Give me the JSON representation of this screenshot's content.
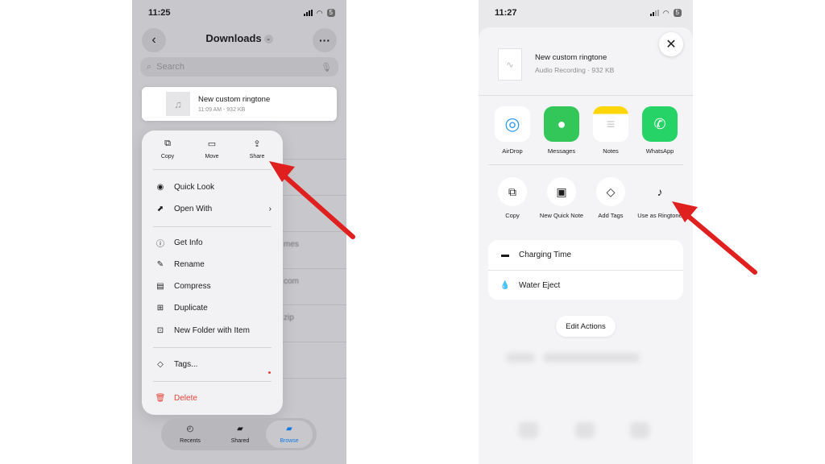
{
  "left": {
    "status": {
      "time": "11:25",
      "battery": "5"
    },
    "nav": {
      "title": "Downloads"
    },
    "search": {
      "placeholder": "Search"
    },
    "file": {
      "name": "New custom ringtone",
      "meta": "11:09 AM - 932 KB"
    },
    "background_fragments": [
      "mes",
      "com",
      "zip"
    ],
    "menu": {
      "top_actions": [
        {
          "label": "Copy",
          "icon": "copy-icon"
        },
        {
          "label": "Move",
          "icon": "folder-icon"
        },
        {
          "label": "Share",
          "icon": "share-icon"
        }
      ],
      "items": [
        {
          "label": "Quick Look",
          "icon": "eye-icon"
        },
        {
          "label": "Open With",
          "icon": "open-with-icon",
          "trailing": "›"
        },
        {
          "label": "Get Info",
          "icon": "info-icon"
        },
        {
          "label": "Rename",
          "icon": "pencil-icon"
        },
        {
          "label": "Compress",
          "icon": "archive-icon"
        },
        {
          "label": "Duplicate",
          "icon": "duplicate-icon"
        },
        {
          "label": "New Folder with Item",
          "icon": "new-folder-icon"
        },
        {
          "label": "Tags...",
          "icon": "tag-icon"
        },
        {
          "label": "Delete",
          "icon": "trash-icon"
        }
      ]
    },
    "tabs": [
      {
        "label": "Recents",
        "icon": "clock-icon"
      },
      {
        "label": "Shared",
        "icon": "shared-folder-icon"
      },
      {
        "label": "Browse",
        "icon": "folder-icon",
        "active": true
      }
    ]
  },
  "right": {
    "status": {
      "time": "11:27",
      "battery": "5"
    },
    "share_header": {
      "title": "New custom ringtone",
      "subtitle": "Audio Recording · 932 KB"
    },
    "apps": [
      {
        "label": "AirDrop",
        "icon": "airdrop-icon",
        "color": "#2f9bf0"
      },
      {
        "label": "Messages",
        "icon": "messages-icon",
        "color": "#33c759"
      },
      {
        "label": "Notes",
        "icon": "notes-icon",
        "color": "#ffd60a"
      },
      {
        "label": "WhatsApp",
        "icon": "whatsapp-icon",
        "color": "#25d366"
      }
    ],
    "actions": [
      {
        "label": "Copy",
        "icon": "copy-icon"
      },
      {
        "label": "New Quick Note",
        "icon": "quick-note-icon"
      },
      {
        "label": "Add Tags",
        "icon": "tag-icon"
      },
      {
        "label": "Use as Ringtone",
        "icon": "music-note-icon"
      }
    ],
    "shortcuts": [
      {
        "label": "Charging Time",
        "icon": "battery-icon"
      },
      {
        "label": "Water Eject",
        "icon": "water-drop-icon"
      }
    ],
    "edit_actions_label": "Edit Actions"
  },
  "annotation_color": "#e01f1f"
}
